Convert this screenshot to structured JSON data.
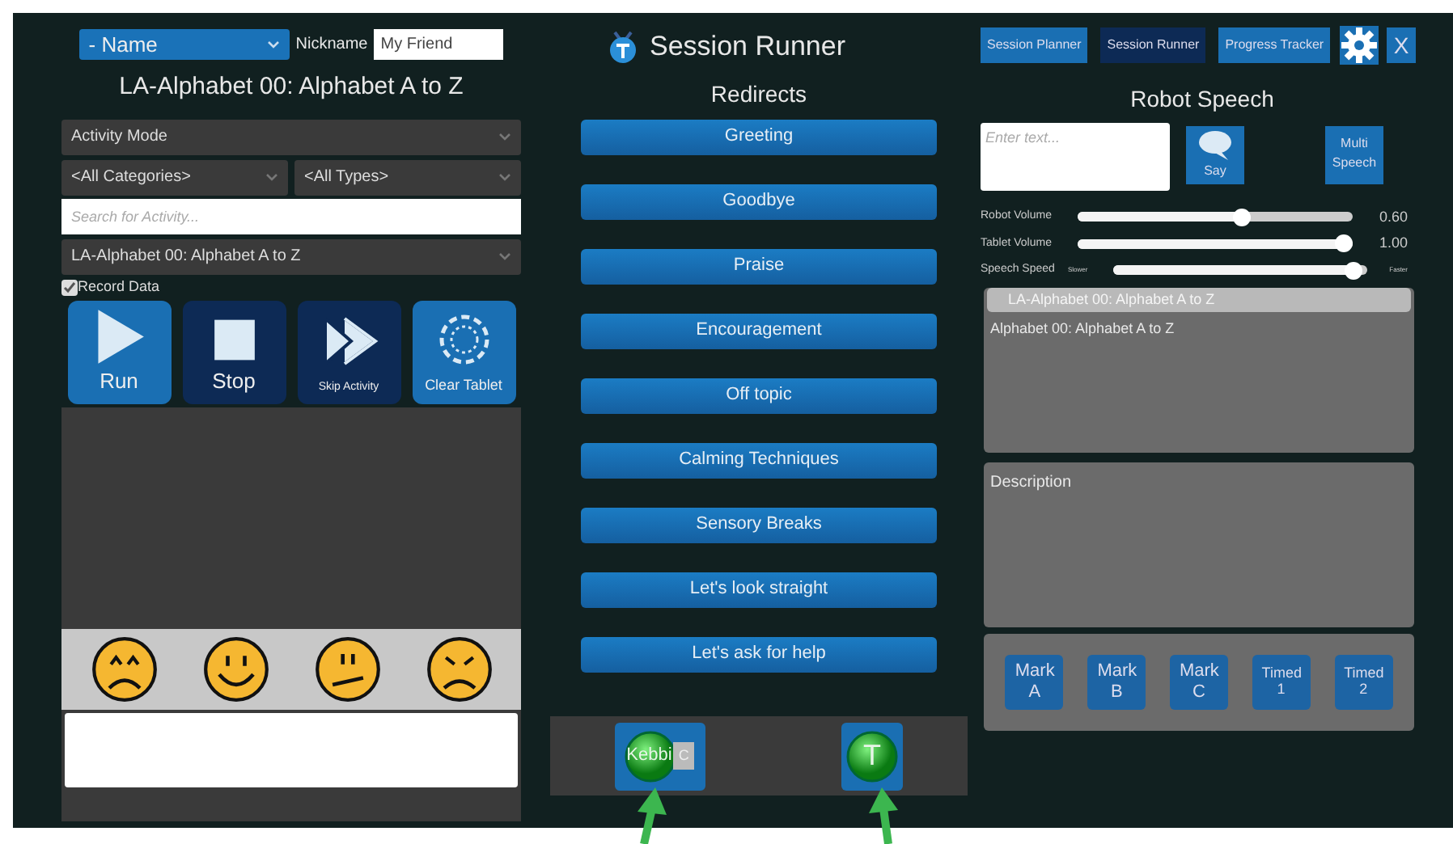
{
  "left": {
    "name_select": "- Name",
    "nickname_label": "Nickname",
    "nickname_value": "My Friend",
    "activity_title": "LA-Alphabet 00: Alphabet A to Z",
    "mode_select": "Activity Mode",
    "category_select": "<All Categories>",
    "type_select": "<All Types>",
    "search_placeholder": "Search for Activity...",
    "activity_select": "LA-Alphabet 00: Alphabet A to Z",
    "record_data": {
      "label": "Record Data",
      "checked": true
    },
    "controls": [
      {
        "kind": "run",
        "label": "Run"
      },
      {
        "kind": "stop",
        "label": "Stop"
      },
      {
        "kind": "skip",
        "label": "Skip Activity"
      },
      {
        "kind": "clear",
        "label": "Clear Tablet"
      }
    ],
    "faces": [
      {
        "kind": "worried"
      },
      {
        "kind": "happy"
      },
      {
        "kind": "neutral"
      },
      {
        "kind": "angry"
      }
    ]
  },
  "center": {
    "title": "Session Runner",
    "redirects_heading": "Redirects",
    "redirects": [
      "Greeting",
      "Goodbye",
      "Praise",
      "Encouragement",
      "Off topic",
      "Calming Techniques",
      "Sensory Breaks",
      "Let's look straight",
      "Let's ask for help"
    ],
    "robots": [
      {
        "kind": "kebbi",
        "label": "Kebbi",
        "badge": "C"
      },
      {
        "kind": "tablet",
        "label": "T"
      }
    ]
  },
  "right": {
    "nav": [
      {
        "label": "Session Planner",
        "selected": false
      },
      {
        "label": "Session Runner",
        "selected": true
      },
      {
        "label": "Progress Tracker",
        "selected": false
      }
    ],
    "close": "X",
    "heading": "Robot Speech",
    "speech_placeholder": "Enter text...",
    "say": "Say",
    "multi": "Multi Speech",
    "sliders": [
      {
        "label": "Robot Volume",
        "level": 0.6,
        "reading": "0.60"
      },
      {
        "label": "Tablet Volume",
        "level": 1.0,
        "reading": "1.00"
      },
      {
        "label": "Speech Speed",
        "min_label": "Slower",
        "max_label": "Faster",
        "level": 0.98
      }
    ],
    "activity_tab": "LA-Alphabet 00: Alphabet A to Z",
    "activity_text": "Alphabet 00: Alphabet A to Z",
    "description": "Description",
    "marks": [
      "Mark A",
      "Mark B",
      "Mark C",
      "Timed 1",
      "Timed 2"
    ]
  }
}
